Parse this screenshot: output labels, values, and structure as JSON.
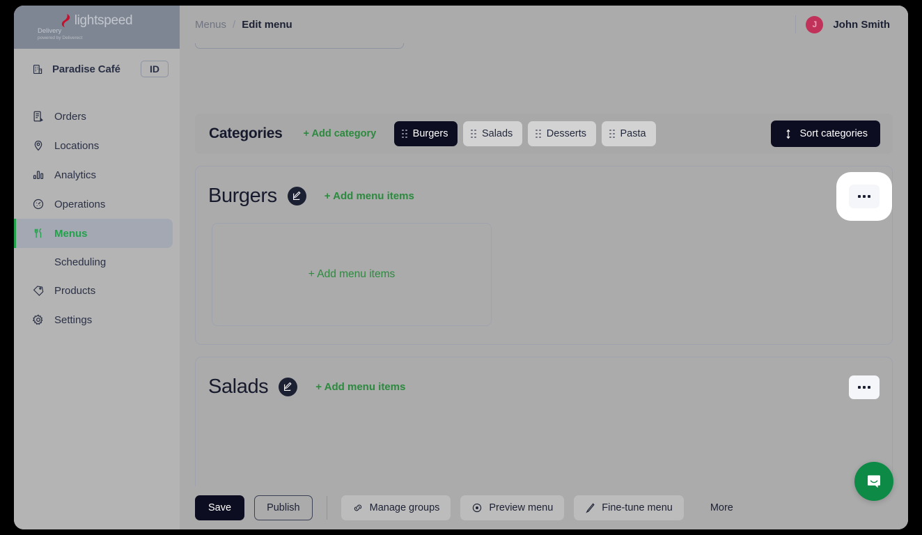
{
  "brand": {
    "name": "lightspeed",
    "product": "Delivery",
    "tagline": "powered by Deliverect"
  },
  "store": {
    "name": "Paradise Café",
    "id_badge": "ID"
  },
  "sidebar": {
    "items": [
      {
        "label": "Orders",
        "icon": "orders-icon",
        "active": false
      },
      {
        "label": "Locations",
        "icon": "location-pin-icon",
        "active": false
      },
      {
        "label": "Analytics",
        "icon": "bar-chart-icon",
        "active": false
      },
      {
        "label": "Operations",
        "icon": "gauge-icon",
        "active": false
      },
      {
        "label": "Menus",
        "icon": "cutlery-icon",
        "active": true
      },
      {
        "label": "Products",
        "icon": "tag-icon",
        "active": false
      },
      {
        "label": "Settings",
        "icon": "gear-icon",
        "active": false
      }
    ],
    "sub_item": {
      "label": "Scheduling"
    }
  },
  "topbar": {
    "breadcrumb": {
      "parent": "Menus",
      "separator": "/",
      "current": "Edit menu"
    },
    "user": {
      "name": "John Smith",
      "initial": "J"
    }
  },
  "categories_bar": {
    "title": "Categories",
    "add_category_label": "+ Add category",
    "sort_label": "Sort categories",
    "sort_icon": "sort-updown-icon",
    "tabs": [
      {
        "label": "Burgers",
        "selected": true
      },
      {
        "label": "Salads",
        "selected": false
      },
      {
        "label": "Desserts",
        "selected": false
      },
      {
        "label": "Pasta",
        "selected": false
      }
    ]
  },
  "sections": [
    {
      "title": "Burgers",
      "edit_icon": "edit-pencil-icon",
      "add_items_label": "+ Add menu items",
      "more_icon": "more-horizontal-icon",
      "more_focused": true,
      "drop_zone_label": "+ Add menu items"
    },
    {
      "title": "Salads",
      "edit_icon": "edit-pencil-icon",
      "add_items_label": "+ Add menu items",
      "more_icon": "more-horizontal-icon",
      "more_focused": false
    }
  ],
  "bottom_bar": {
    "save_label": "Save",
    "publish_label": "Publish",
    "manage_groups_label": "Manage groups",
    "manage_groups_icon": "link-chain-icon",
    "preview_menu_label": "Preview menu",
    "preview_menu_icon": "eye-icon",
    "fine_tune_label": "Fine-tune menu",
    "fine_tune_icon": "pencil-icon",
    "more_label": "More"
  },
  "support": {
    "widget_icon": "intercom-chat-icon"
  },
  "colors": {
    "accent_green": "#2b8a3e",
    "dark": "#0d0d21",
    "brand_red": "#c8102e",
    "avatar": "#c03259",
    "intercom": "#0c8a46"
  }
}
